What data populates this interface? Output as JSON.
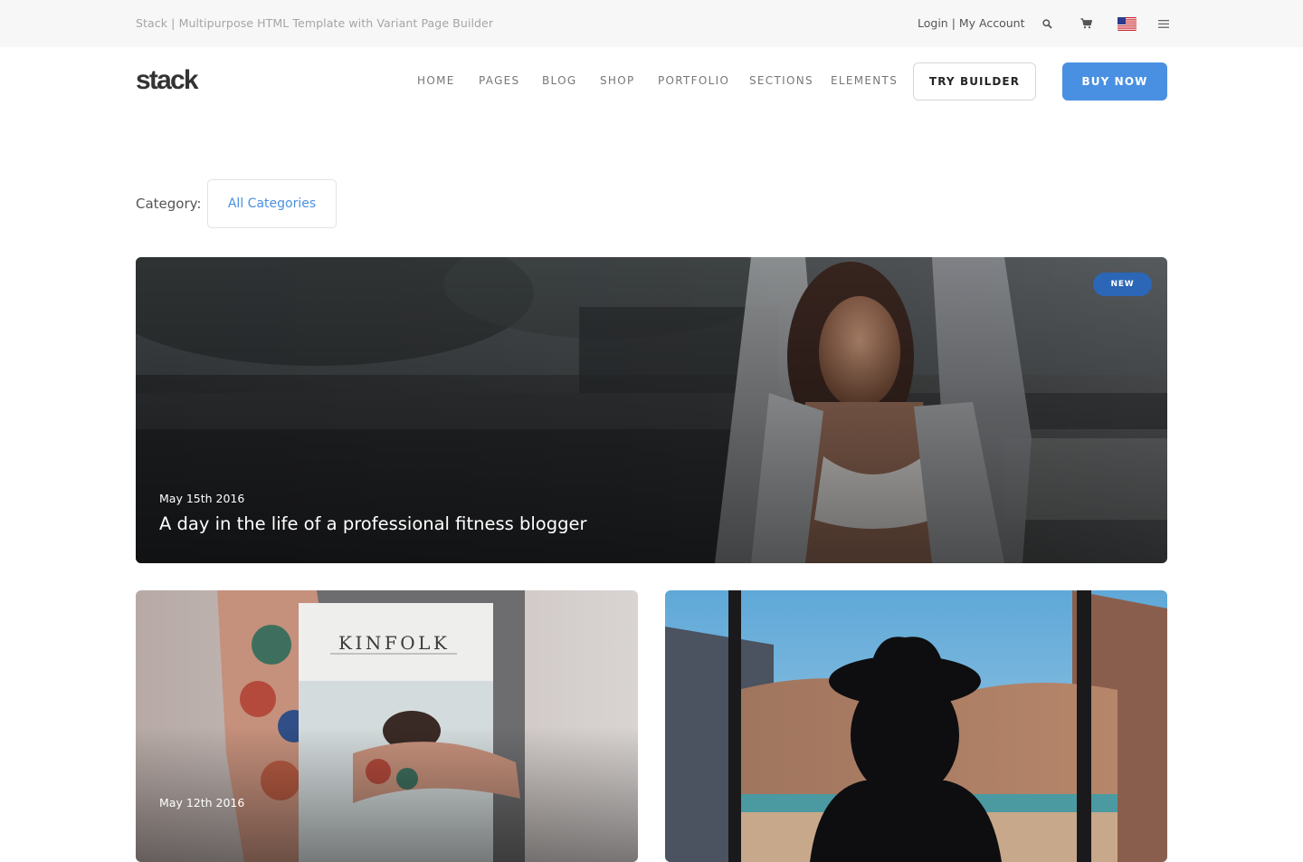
{
  "utility_bar": {
    "site_title": "Stack | Multipurpose HTML Template with Variant Page Builder",
    "account_links": "Login | My Account",
    "icons": [
      "search-icon",
      "cart-icon",
      "us-flag-icon",
      "menu-icon"
    ]
  },
  "header": {
    "logo": "stack",
    "nav": [
      "HOME",
      "PAGES",
      "BLOG",
      "SHOP",
      "PORTFOLIO",
      "SECTIONS",
      "ELEMENTS"
    ],
    "try_builder": "TRY BUILDER",
    "buy_now": "BUY NOW"
  },
  "filter": {
    "label": "Category:",
    "selected": "All Categories"
  },
  "posts": [
    {
      "date": "May 15th 2016",
      "title": "A day in the life of a professional fitness blogger",
      "badge": "NEW"
    },
    {
      "date": "May 12th 2016",
      "cover_text": "KINFOLK"
    },
    {
      "date": ""
    }
  ],
  "colors": {
    "accent": "#4a90e2",
    "badge": "#2c66b6",
    "utility_bg": "#f7f7f7"
  }
}
